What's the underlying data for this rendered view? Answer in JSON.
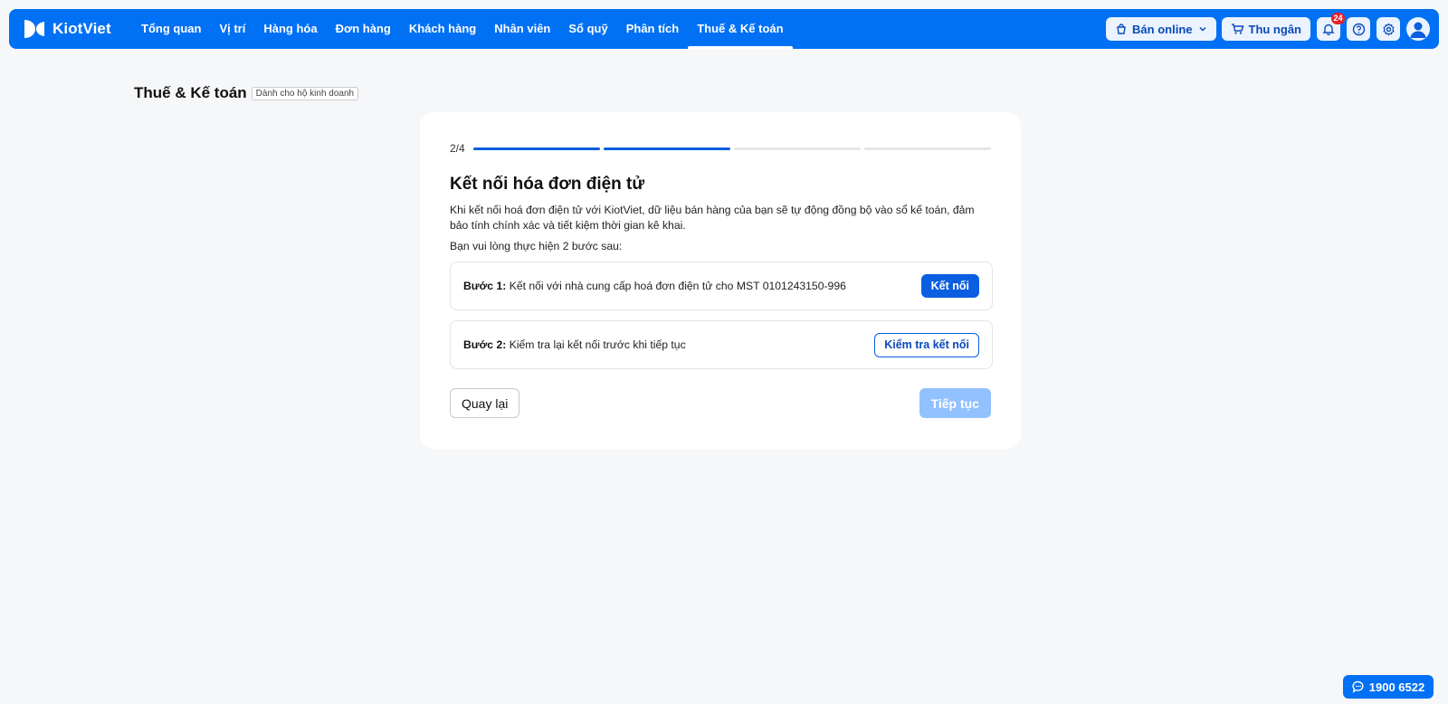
{
  "brand": {
    "name": "KiotViet"
  },
  "nav": {
    "items": [
      {
        "label": "Tổng quan"
      },
      {
        "label": "Vị trí"
      },
      {
        "label": "Hàng hóa"
      },
      {
        "label": "Đơn hàng"
      },
      {
        "label": "Khách hàng"
      },
      {
        "label": "Nhân viên"
      },
      {
        "label": "Sổ quỹ"
      },
      {
        "label": "Phân tích"
      },
      {
        "label": "Thuế & Kế toán",
        "active": true
      }
    ]
  },
  "top_actions": {
    "sell_online": "Bán online",
    "cashier": "Thu ngân",
    "notification_count": "24",
    "icons": [
      "bell-icon",
      "help-icon",
      "gear-icon",
      "user-avatar-icon"
    ]
  },
  "page": {
    "title": "Thuế & Kế toán",
    "tag": "Dành cho hộ kinh doanh"
  },
  "wizard": {
    "progress_label": "2/4",
    "current_step": 2,
    "total_steps": 4,
    "title": "Kết nối hóa đơn điện tử",
    "description": "Khi kết nối hoá đơn điện tử với KiotViet, dữ liệu bán hàng của bạn sẽ tự động đồng bộ vào sổ kế toán, đảm bảo tính chính xác và tiết kiệm thời gian kê khai.",
    "instruction": "Bạn vui lòng thực hiện 2 bước sau:",
    "steps": [
      {
        "prefix": "Bước 1:",
        "text": "Kết nối với nhà cung cấp hoá đơn điện tử cho MST 0101243150-996",
        "button": "Kết nối"
      },
      {
        "prefix": "Bước 2:",
        "text": "Kiểm tra lại kết nối trước khi tiếp tục",
        "button": "Kiểm tra kết nối"
      }
    ],
    "back_label": "Quay lại",
    "next_label": "Tiếp tục"
  },
  "hotline": {
    "number": "1900 6522"
  },
  "colors": {
    "brand_blue": "#0070f4",
    "primary": "#0a5ee0",
    "disabled_primary": "#92c1ff",
    "page_bg": "#f6f7f9",
    "badge_red": "#e8212e"
  }
}
